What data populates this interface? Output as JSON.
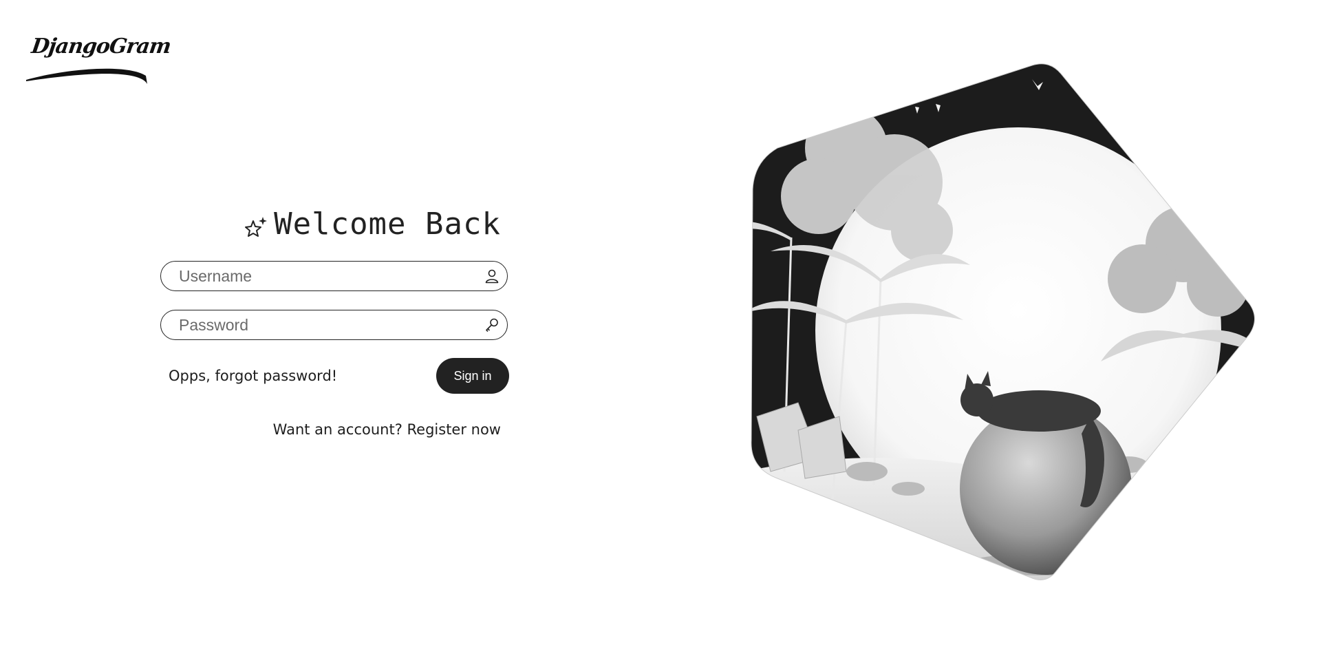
{
  "brand": {
    "logo_text": "DjangoGram"
  },
  "login": {
    "title": "Welcome Back",
    "username_placeholder": "Username",
    "password_placeholder": "Password",
    "forgot_label": "Opps, forgot password!",
    "signin_label": "Sign in",
    "register_label": "Want an account? Register now"
  },
  "icons": {
    "title_icon": "sparkle-star-icon",
    "username_icon": "user-icon",
    "password_icon": "key-icon"
  },
  "colors": {
    "primary_button": "#222222",
    "background": "#ffffff",
    "text": "#1e1e1e"
  }
}
